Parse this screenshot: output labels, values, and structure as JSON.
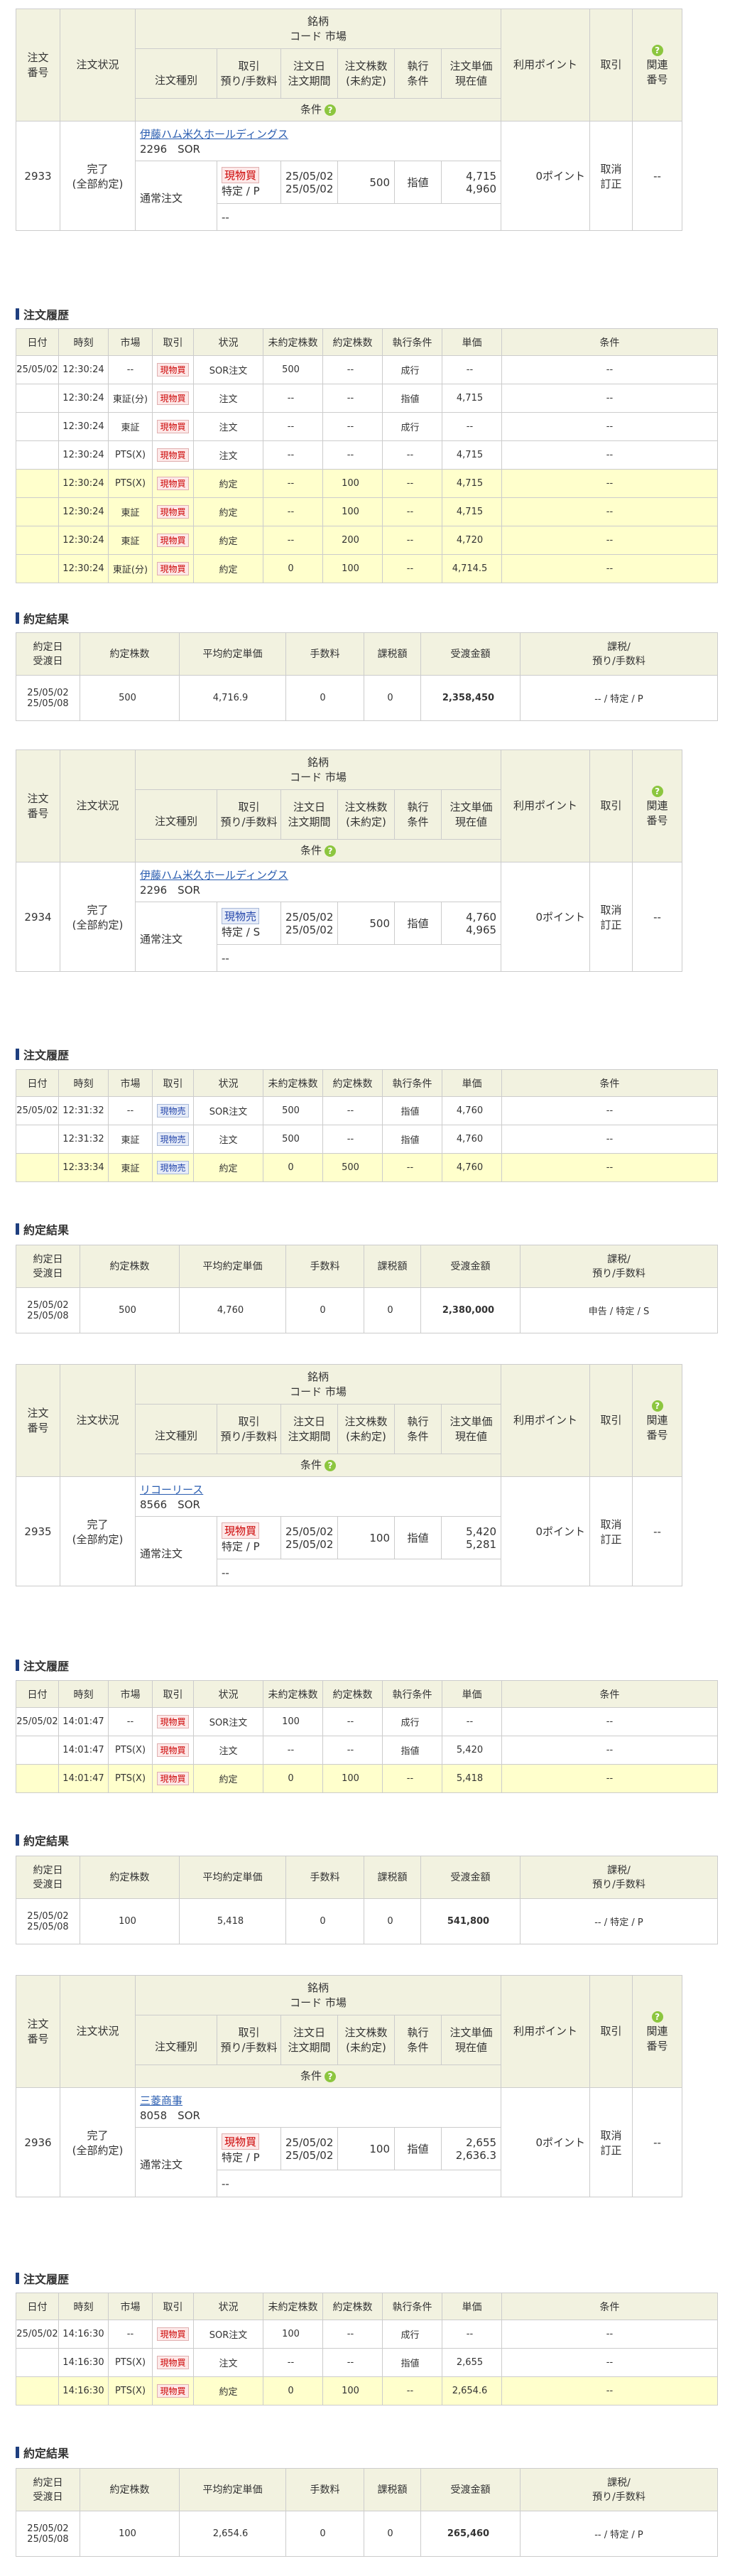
{
  "headers": {
    "order_no": [
      "注文",
      "番号"
    ],
    "status": "注文状況",
    "meigara": "銘柄",
    "code_market": "コード 市場",
    "order_type": "注文種別",
    "torihiki": [
      "取引",
      "預り/手数料"
    ],
    "order_date": [
      "注文日",
      "注文期間"
    ],
    "shares": [
      "注文株数",
      "(未約定)"
    ],
    "exec_cond": [
      "執行",
      "条件"
    ],
    "price": [
      "注文単価",
      "現在値"
    ],
    "jouken": "条件",
    "points": "利用ポイント",
    "torihiki2": "取引",
    "related": [
      "関連",
      "番号"
    ]
  },
  "history_title": "注文履歴",
  "history_headers": [
    "日付",
    "時刻",
    "市場",
    "取引",
    "状況",
    "未約定株数",
    "約定株数",
    "執行条件",
    "単価",
    "条件"
  ],
  "result_title": "約定結果",
  "result_headers": [
    [
      "約定日",
      "受渡日"
    ],
    "約定株数",
    "平均約定単価",
    "手数料",
    "課税額",
    "受渡金額",
    [
      "課税/",
      "預り/手数料"
    ]
  ],
  "orders": [
    {
      "no": "2933",
      "status": [
        "完了",
        "(全部約定)"
      ],
      "stock_name": "伊藤ハム米久ホールディングス",
      "stock_code": "2296　SOR",
      "type": "通常注文",
      "side": "現物買",
      "account": "特定 / P",
      "date1": "25/05/02",
      "date2": "25/05/02",
      "shares": "500",
      "exec": "指値",
      "price1": "4,715",
      "price2": "4,960",
      "cond": "--",
      "points": "0ポイント",
      "actions": [
        "取消",
        "訂正"
      ],
      "related": "--",
      "history": [
        [
          "25/05/02",
          "12:30:24",
          "--",
          "現物買",
          "SOR注文",
          "500",
          "--",
          "成行",
          "--",
          "--"
        ],
        [
          "",
          "12:30:24",
          "東証(分)",
          "現物買",
          "注文",
          "--",
          "--",
          "指値",
          "4,715",
          "--"
        ],
        [
          "",
          "12:30:24",
          "東証",
          "現物買",
          "注文",
          "--",
          "--",
          "成行",
          "--",
          "--"
        ],
        [
          "",
          "12:30:24",
          "PTS(X)",
          "現物買",
          "注文",
          "--",
          "--",
          "--",
          "4,715",
          "--"
        ],
        [
          "",
          "12:30:24",
          "PTS(X)",
          "現物買",
          "約定",
          "--",
          "100",
          "--",
          "4,715",
          "--"
        ],
        [
          "",
          "12:30:24",
          "東証",
          "現物買",
          "約定",
          "--",
          "100",
          "--",
          "4,715",
          "--"
        ],
        [
          "",
          "12:30:24",
          "東証",
          "現物買",
          "約定",
          "--",
          "200",
          "--",
          "4,720",
          "--"
        ],
        [
          "",
          "12:30:24",
          "東証(分)",
          "現物買",
          "約定",
          "0",
          "100",
          "--",
          "4,714.5",
          "--"
        ]
      ],
      "result": [
        "25/05/02",
        "25/05/08",
        "500",
        "4,716.9",
        "0",
        "0",
        "2,358,450",
        "-- / 特定 / P"
      ]
    },
    {
      "no": "2934",
      "status": [
        "完了",
        "(全部約定)"
      ],
      "stock_name": "伊藤ハム米久ホールディングス",
      "stock_code": "2296　SOR",
      "type": "通常注文",
      "side": "現物売",
      "account": "特定 / S",
      "date1": "25/05/02",
      "date2": "25/05/02",
      "shares": "500",
      "exec": "指値",
      "price1": "4,760",
      "price2": "4,965",
      "cond": "--",
      "points": "0ポイント",
      "actions": [
        "取消",
        "訂正"
      ],
      "related": "--",
      "history": [
        [
          "25/05/02",
          "12:31:32",
          "--",
          "現物売",
          "SOR注文",
          "500",
          "--",
          "指値",
          "4,760",
          "--"
        ],
        [
          "",
          "12:31:32",
          "東証",
          "現物売",
          "注文",
          "500",
          "--",
          "指値",
          "4,760",
          "--"
        ],
        [
          "",
          "12:33:34",
          "東証",
          "現物売",
          "約定",
          "0",
          "500",
          "--",
          "4,760",
          "--"
        ]
      ],
      "result": [
        "25/05/02",
        "25/05/08",
        "500",
        "4,760",
        "0",
        "0",
        "2,380,000",
        "申告 / 特定 / S"
      ]
    },
    {
      "no": "2935",
      "status": [
        "完了",
        "(全部約定)"
      ],
      "stock_name": "リコーリース",
      "stock_code": "8566　SOR",
      "type": "通常注文",
      "side": "現物買",
      "account": "特定 / P",
      "date1": "25/05/02",
      "date2": "25/05/02",
      "shares": "100",
      "exec": "指値",
      "price1": "5,420",
      "price2": "5,281",
      "cond": "--",
      "points": "0ポイント",
      "actions": [
        "取消",
        "訂正"
      ],
      "related": "--",
      "history": [
        [
          "25/05/02",
          "14:01:47",
          "--",
          "現物買",
          "SOR注文",
          "100",
          "--",
          "成行",
          "--",
          "--"
        ],
        [
          "",
          "14:01:47",
          "PTS(X)",
          "現物買",
          "注文",
          "--",
          "--",
          "指値",
          "5,420",
          "--"
        ],
        [
          "",
          "14:01:47",
          "PTS(X)",
          "現物買",
          "約定",
          "0",
          "100",
          "--",
          "5,418",
          "--"
        ]
      ],
      "result": [
        "25/05/02",
        "25/05/08",
        "100",
        "5,418",
        "0",
        "0",
        "541,800",
        "-- / 特定 / P"
      ]
    },
    {
      "no": "2936",
      "status": [
        "完了",
        "(全部約定)"
      ],
      "stock_name": "三菱商事",
      "stock_code": "8058　SOR",
      "type": "通常注文",
      "side": "現物買",
      "account": "特定 / P",
      "date1": "25/05/02",
      "date2": "25/05/02",
      "shares": "100",
      "exec": "指値",
      "price1": "2,655",
      "price2": "2,636.3",
      "cond": "--",
      "points": "0ポイント",
      "actions": [
        "取消",
        "訂正"
      ],
      "related": "--",
      "history": [
        [
          "25/05/02",
          "14:16:30",
          "--",
          "現物買",
          "SOR注文",
          "100",
          "--",
          "成行",
          "--",
          "--"
        ],
        [
          "",
          "14:16:30",
          "PTS(X)",
          "現物買",
          "注文",
          "--",
          "--",
          "指値",
          "2,655",
          "--"
        ],
        [
          "",
          "14:16:30",
          "PTS(X)",
          "現物買",
          "約定",
          "0",
          "100",
          "--",
          "2,654.6",
          "--"
        ]
      ],
      "result": [
        "25/05/02",
        "25/05/08",
        "100",
        "2,654.6",
        "0",
        "0",
        "265,460",
        "-- / 特定 / P"
      ]
    }
  ]
}
